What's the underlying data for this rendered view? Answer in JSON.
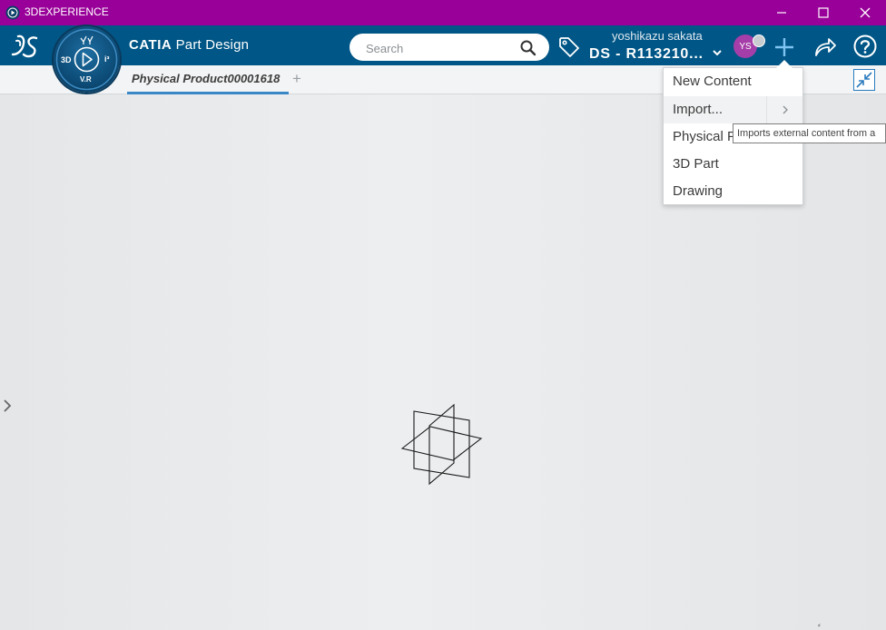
{
  "window": {
    "title": "3DEXPERIENCE",
    "controls": [
      "minimize-icon",
      "maximize-icon",
      "close-icon"
    ]
  },
  "header": {
    "app_brand": "CATIA",
    "app_module": "Part Design",
    "compass": {
      "label_3d": "3D",
      "label_vr": "V.R",
      "label_i": "i³"
    },
    "search": {
      "placeholder": "Search",
      "value": ""
    },
    "user": {
      "name": "yoshikazu sakata",
      "tenant": "DS - R113210..."
    },
    "avatar": {
      "initials": "YS",
      "color": "#a53ea8"
    },
    "colors": {
      "header_bg": "#005686",
      "titlebar_bg": "#990099"
    }
  },
  "tabs": [
    {
      "label": "Physical Product00001618",
      "active": true
    }
  ],
  "tab_add_label": "+",
  "menu": {
    "items": [
      {
        "label": "New Content"
      },
      {
        "label": "Import...",
        "has_submenu": true
      },
      {
        "label": "Physical P"
      },
      {
        "label": "3D Part"
      },
      {
        "label": "Drawing"
      }
    ]
  },
  "tooltip": {
    "text": "Imports external content from a"
  }
}
